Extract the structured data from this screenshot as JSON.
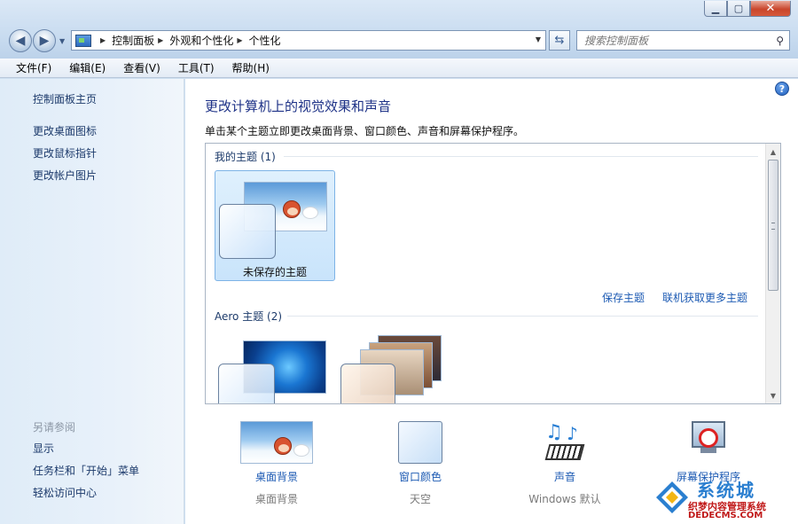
{
  "window": {
    "minimize_glyph": "▁",
    "maximize_glyph": "▢",
    "close_glyph": "✕"
  },
  "address_bar": {
    "crumbs": [
      "控制面板",
      "外观和个性化",
      "个性化"
    ]
  },
  "search": {
    "placeholder": "搜索控制面板"
  },
  "menu": {
    "file": "文件(F)",
    "edit": "编辑(E)",
    "view": "查看(V)",
    "tools": "工具(T)",
    "help": "帮助(H)"
  },
  "sidebar": {
    "home": "控制面板主页",
    "links": [
      "更改桌面图标",
      "更改鼠标指针",
      "更改帐户图片"
    ],
    "see_also_title": "另请参阅",
    "see_also": [
      "显示",
      "任务栏和「开始」菜单",
      "轻松访问中心"
    ]
  },
  "main": {
    "heading": "更改计算机上的视觉效果和声音",
    "subtitle": "单击某个主题立即更改桌面背景、窗口颜色、声音和屏幕保护程序。",
    "my_themes_label": "我的主题 (1)",
    "unsaved_theme_name": "未保存的主题",
    "save_theme": "保存主题",
    "get_more_themes": "联机获取更多主题",
    "aero_themes_label": "Aero 主题 (2)"
  },
  "bottom": {
    "desktop_background": {
      "label": "桌面背景",
      "value": "桌面背景"
    },
    "window_color": {
      "label": "窗口颜色",
      "value": "天空"
    },
    "sounds": {
      "label": "声音",
      "value": "Windows 默认"
    },
    "screensaver": {
      "label": "屏幕保护程序"
    }
  },
  "watermark": {
    "title": "系统城",
    "line1": "织梦内容管理系统",
    "line2": "DEDECMS.COM"
  },
  "icons": {
    "back": "back-arrow-icon",
    "forward": "forward-arrow-icon",
    "refresh": "refresh-icon",
    "search": "magnifier-icon",
    "help": "help-icon"
  },
  "colors": {
    "link": "#1c5ab3",
    "heading": "#1e3287",
    "selection": "#c9e4fb"
  }
}
